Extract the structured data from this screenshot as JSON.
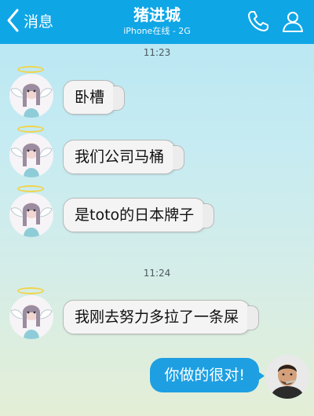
{
  "header": {
    "back_label": "消息",
    "title": "猪进城",
    "subtitle": "iPhone在线 - 2G",
    "icons": [
      "chevron-left-icon",
      "phone-icon",
      "profile-icon"
    ],
    "bg_color": "#0fa6e6"
  },
  "chat": {
    "groups": [
      {
        "time": "11:23",
        "messages": [
          {
            "from": "contact",
            "text": "卧槽"
          },
          {
            "from": "contact",
            "text": "我们公司马桶"
          },
          {
            "from": "contact",
            "text": "是toto的日本牌子"
          }
        ]
      },
      {
        "time": "11:24",
        "messages": [
          {
            "from": "contact",
            "text": "我刚去努力多拉了一条屎"
          },
          {
            "from": "me",
            "text": "你做的很对!"
          }
        ]
      }
    ]
  },
  "colors": {
    "incoming_bubble": "#f4f4f4",
    "outgoing_bubble": "#1e9fe2"
  }
}
